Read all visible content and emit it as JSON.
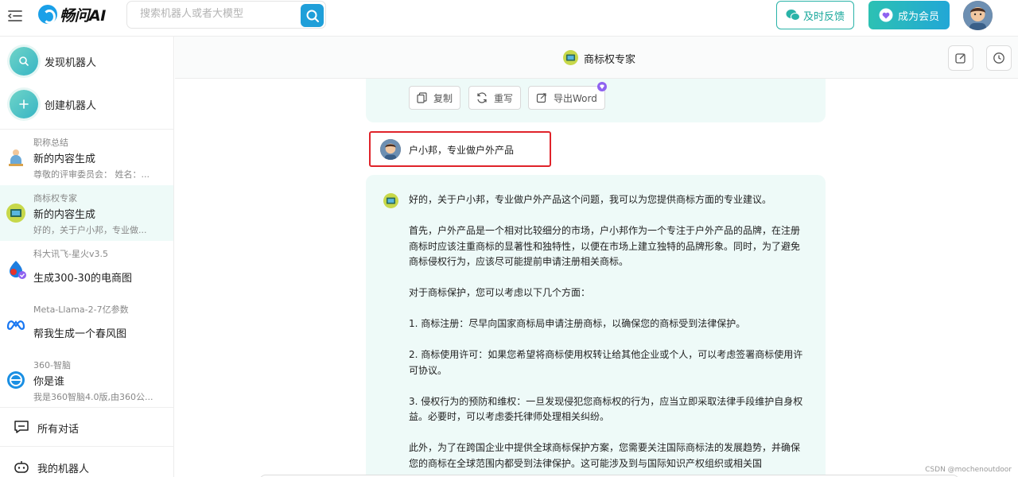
{
  "app": {
    "logo_text": "畅问AI",
    "search_placeholder": "搜索机器人或者大模型",
    "feedback_label": "及时反馈",
    "member_label": "成为会员"
  },
  "sidebar": {
    "discover_label": "发现机器人",
    "create_label": "创建机器人",
    "conversations": [
      {
        "bot": "职称总结",
        "title": "新的内容生成",
        "preview": "尊敬的评审委员会： 姓名：..."
      },
      {
        "bot": "商标权专家",
        "title": "新的内容生成",
        "preview": "好的，关于户小邦，专业做..."
      },
      {
        "bot": "科大讯飞-星火v3.5",
        "title": "生成300-30的电商图",
        "preview": ""
      },
      {
        "bot": "Meta-Llama-2-7亿参数",
        "title": "帮我生成一个春风图",
        "preview": ""
      },
      {
        "bot": "360-智脑",
        "title": "你是谁",
        "preview": "我是360智脑4.0版,由360公..."
      }
    ],
    "all_conversations_label": "所有对话",
    "my_bots_label": "我的机器人"
  },
  "chat": {
    "bot_name": "商标权专家",
    "actions": {
      "copy": "复制",
      "rewrite": "重写",
      "export": "导出Word"
    },
    "user_message": "户小邦，专业做户外产品",
    "bot_paragraphs": [
      "好的，关于户小邦，专业做户外产品这个问题，我可以为您提供商标方面的专业建议。",
      "首先，户外产品是一个相对比较细分的市场，户小邦作为一个专注于户外产品的品牌，在注册商标时应该注重商标的显著性和独特性，以便在市场上建立独特的品牌形象。同时，为了避免商标侵权行为，应该尽可能提前申请注册相关商标。",
      "对于商标保护，您可以考虑以下几个方面：",
      "1. 商标注册：尽早向国家商标局申请注册商标，以确保您的商标受到法律保护。",
      "2. 商标使用许可：如果您希望将商标使用权转让给其他企业或个人，可以考虑签署商标使用许可协议。",
      "3. 侵权行为的预防和维权：一旦发现侵犯您商标权的行为，应当立即采取法律手段维护自身权益。必要时，可以考虑委托律师处理相关纠纷。",
      "此外，为了在跨国企业中提供全球商标保护方案，您需要关注国际商标法的发展趋势，并确保您的商标在全球范围内都受到法律保护。这可能涉及到与国际知识产权组织或相关国"
    ]
  },
  "watermark": "CSDN @mochenoutdoor"
}
